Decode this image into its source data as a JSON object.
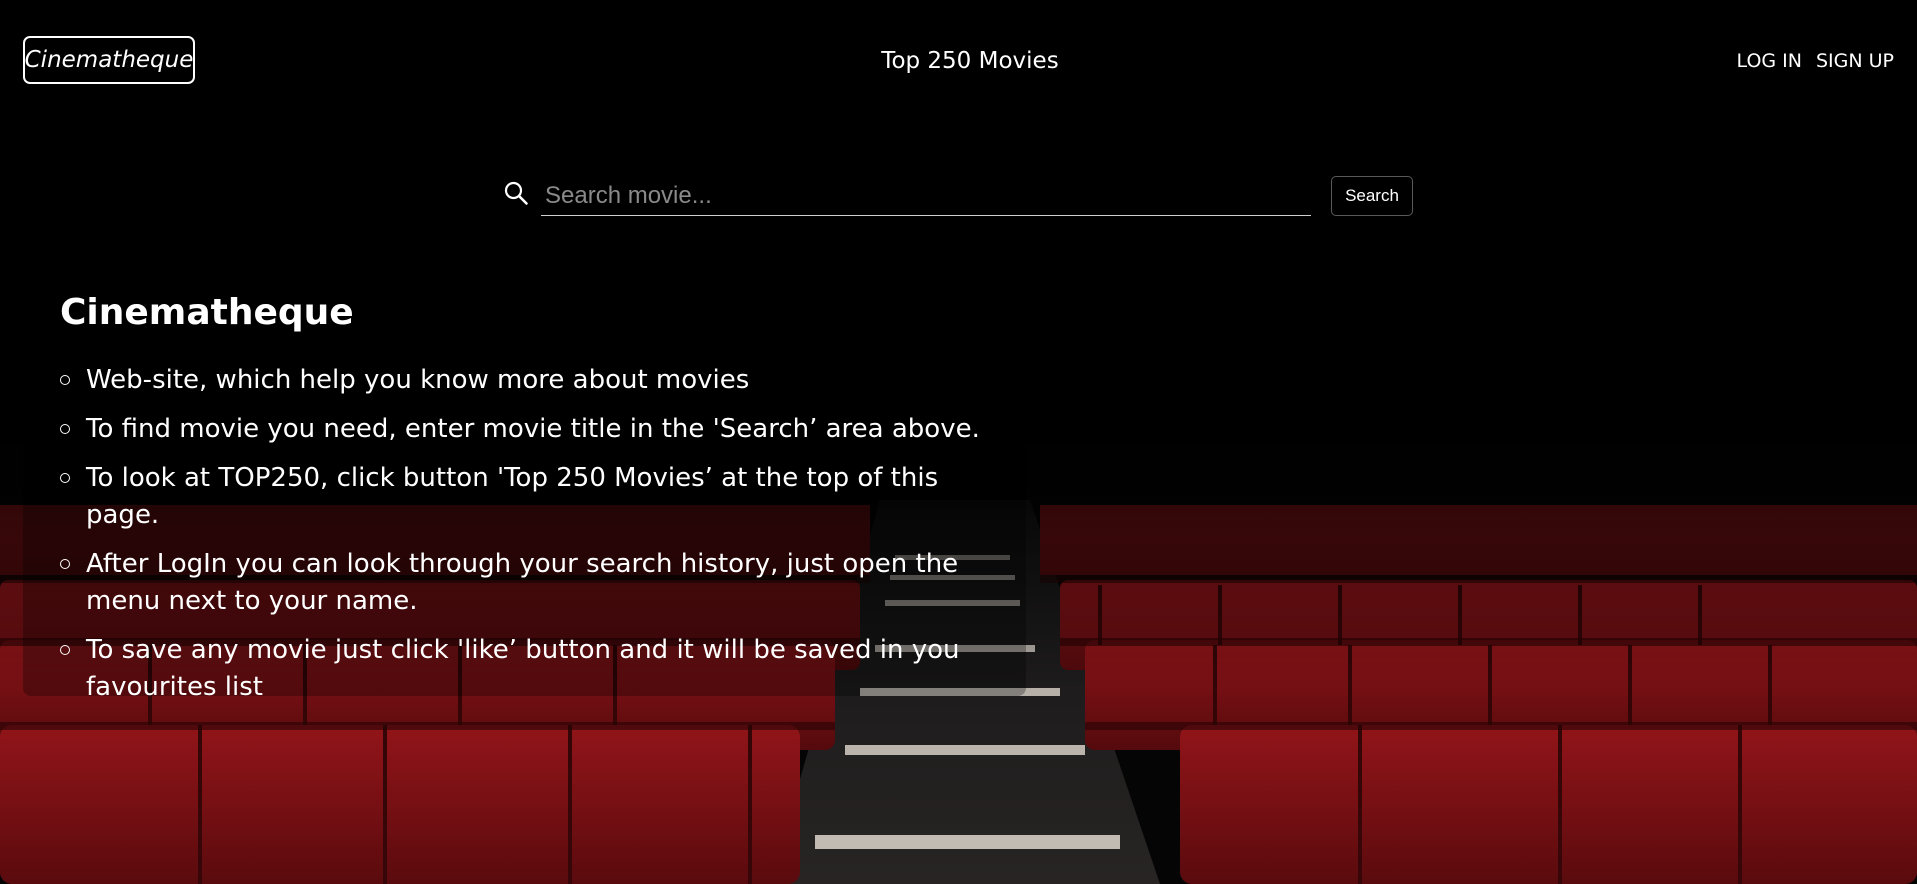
{
  "header": {
    "logo": "Cinematheque",
    "top_link": "Top 250 Movies",
    "login": "LOG IN",
    "signup": "SIGN UP"
  },
  "search": {
    "placeholder": "Search movie...",
    "value": "",
    "button": "Search"
  },
  "info": {
    "title": "Cinematheque",
    "items": [
      "Web-site, which help you know more about movies",
      "To find movie you need, enter movie title in the 'Search’ area above.",
      "To look at TOP250, click button 'Top 250 Movies’ at the top of this page.",
      "After LogIn you can look through your search history, just open the menu next to your name.",
      "To save any movie just click 'like’ button and it will be saved in you favourites list"
    ]
  },
  "colors": {
    "background": "#050505",
    "seat_red": "#8e1418",
    "text": "#ffffff"
  },
  "icons": {
    "search": "search-icon"
  }
}
